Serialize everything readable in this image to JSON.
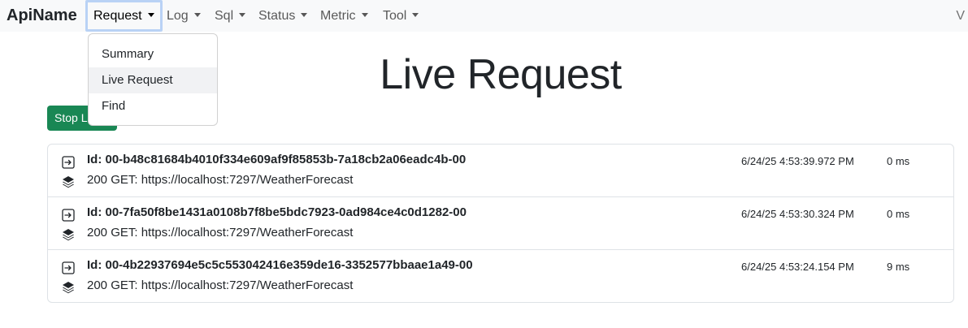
{
  "navbar": {
    "brand": "ApiName",
    "items": [
      {
        "label": "Request"
      },
      {
        "label": "Log"
      },
      {
        "label": "Sql"
      },
      {
        "label": "Status"
      },
      {
        "label": "Metric"
      },
      {
        "label": "Tool"
      }
    ],
    "right_text": "V"
  },
  "dropdown": {
    "items": [
      {
        "label": "Summary"
      },
      {
        "label": "Live Request"
      },
      {
        "label": "Find"
      }
    ],
    "highlighted": "Live Request"
  },
  "page": {
    "title": "Live Request",
    "stop_button_label": "Stop Live"
  },
  "requests": [
    {
      "id": "Id: 00-b48c81684b4010f334e609af9f85853b-7a18cb2a06eadc4b-00",
      "desc": "200 GET: https://localhost:7297/WeatherForecast",
      "time": "6/24/25 4:53:39.972 PM",
      "duration": "0 ms"
    },
    {
      "id": "Id: 00-7fa50f8be1431a0108b7f8be5bdc7923-0ad984ce4c0d1282-00",
      "desc": "200 GET: https://localhost:7297/WeatherForecast",
      "time": "6/24/25 4:53:30.324 PM",
      "duration": "0 ms"
    },
    {
      "id": "Id: 00-4b22937694e5c5c553042416e359de16-3352577bbaae1a49-00",
      "desc": "200 GET: https://localhost:7297/WeatherForecast",
      "time": "6/24/25 4:53:24.154 PM",
      "duration": "9 ms"
    }
  ],
  "colors": {
    "navbar_bg": "#f8f9fa",
    "success_button": "#198754",
    "active_outline": "#b9d2f5",
    "border": "#dee2e6"
  },
  "icons": {
    "row_top": "enter-box-icon",
    "row_bottom": "layers-stack-icon",
    "nav_caret": "caret-down-icon"
  }
}
